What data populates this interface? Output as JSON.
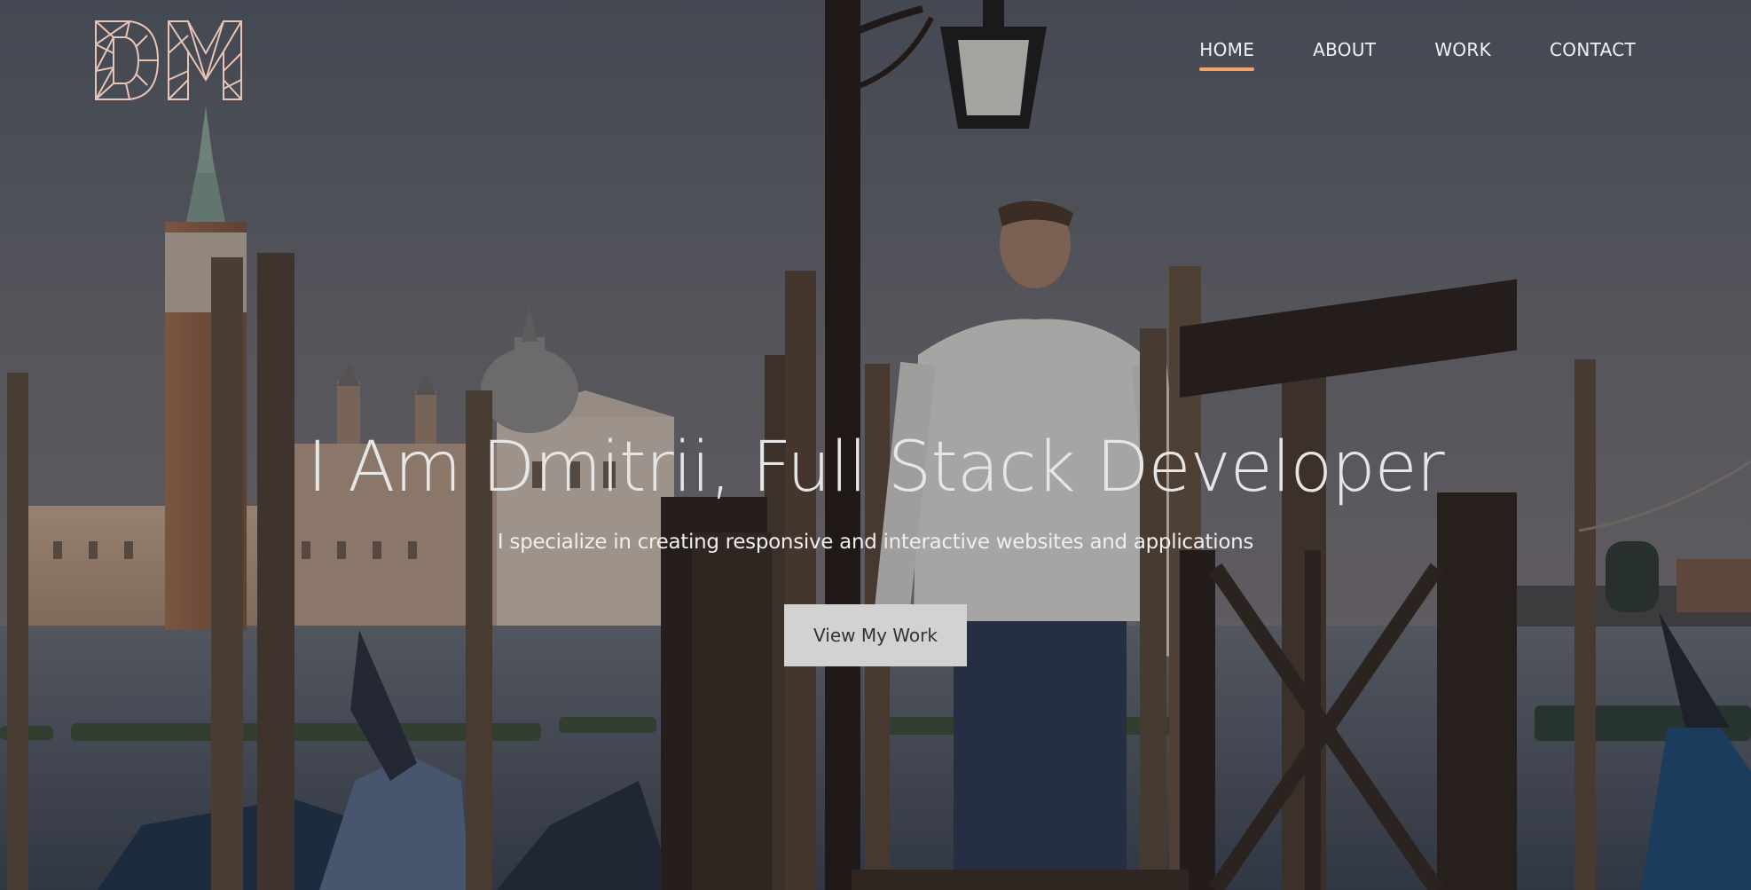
{
  "logo": {
    "text": "DM",
    "accent": "#e8c4b4"
  },
  "nav": {
    "items": [
      {
        "label": "HOME",
        "active": true
      },
      {
        "label": "ABOUT",
        "active": false
      },
      {
        "label": "WORK",
        "active": false
      },
      {
        "label": "CONTACT",
        "active": false
      }
    ],
    "active_color": "#f0a46a"
  },
  "hero": {
    "headline": "I Am Dmitrii, Full Stack Developer",
    "subheadline": "I specialize in creating responsive and interactive websites and applications",
    "cta_label": "View My Work"
  },
  "background": {
    "description_icon": "venice-pier-photo"
  }
}
